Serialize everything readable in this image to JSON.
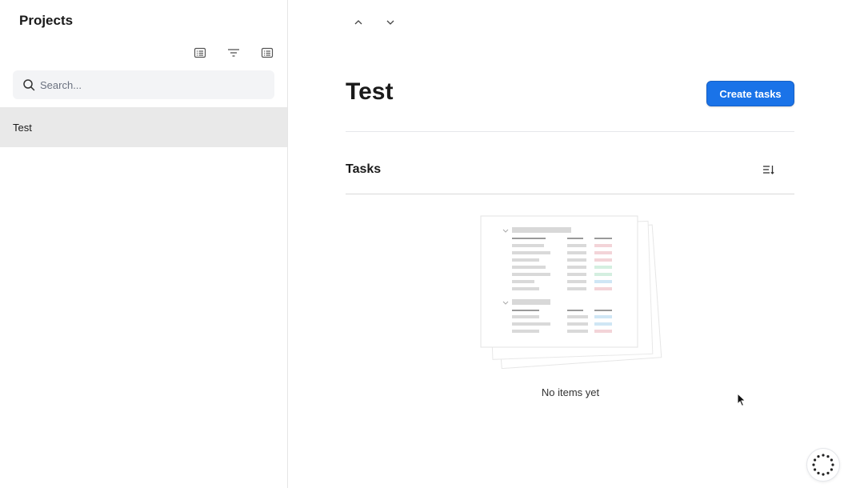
{
  "sidebar": {
    "title": "Projects",
    "tools": [
      {
        "icon": "list-view-icon"
      },
      {
        "icon": "filter-icon"
      },
      {
        "icon": "list-options-icon"
      }
    ],
    "search": {
      "placeholder": "Search...",
      "value": ""
    },
    "items": [
      {
        "label": "Test",
        "selected": true
      }
    ]
  },
  "main": {
    "nav": {
      "up_icon": "chevron-up-icon",
      "down_icon": "chevron-down-icon"
    },
    "title": "Test",
    "create_button": "Create tasks",
    "section": {
      "title": "Tasks",
      "sort_icon": "sort-icon",
      "empty_text": "No items yet"
    }
  },
  "colors": {
    "accent": "#1a73e8",
    "selected_row": "#e9e9e9",
    "search_bg": "#f3f4f6"
  }
}
